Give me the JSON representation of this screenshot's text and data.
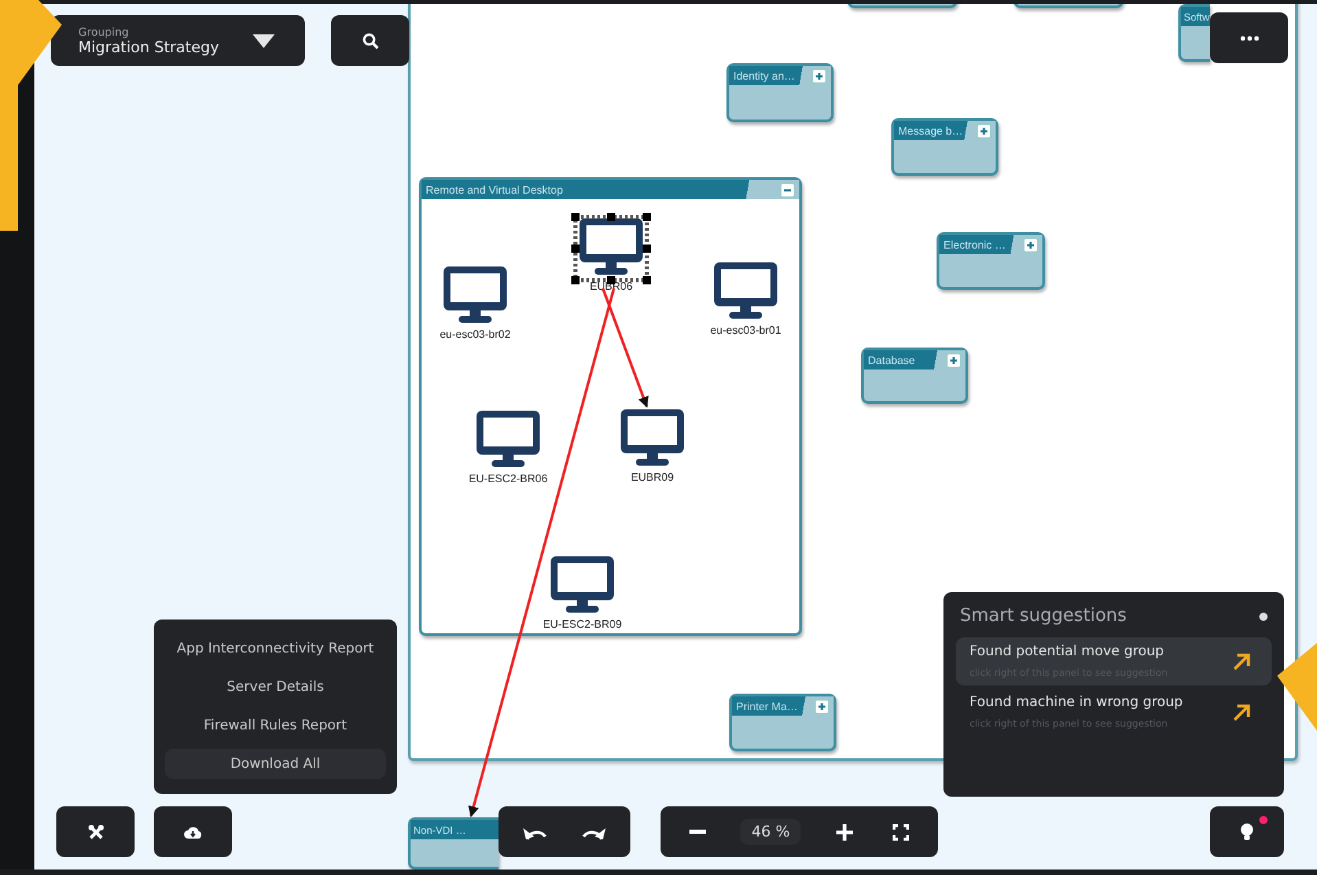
{
  "grouping": {
    "label": "Grouping",
    "value": "Migration Strategy"
  },
  "diagram": {
    "groups": [
      {
        "label": "Remote and Virtual Desktop",
        "expanded": true,
        "nodes": [
          {
            "label": "EUBR06",
            "selected": true
          },
          {
            "label": "eu-esc03-br02",
            "selected": false
          },
          {
            "label": "eu-esc03-br01",
            "selected": false
          },
          {
            "label": "EU-ESC2-BR06",
            "selected": false
          },
          {
            "label": "EUBR09",
            "selected": false
          },
          {
            "label": "EU-ESC2-BR09",
            "selected": false
          }
        ]
      },
      {
        "expanded": false
      },
      {
        "expanded": false
      },
      {
        "label": "Softw",
        "expanded": false
      },
      {
        "label": "Identity an…",
        "expanded": false
      },
      {
        "label": "Message b…",
        "expanded": false
      },
      {
        "label": "Electronic …",
        "expanded": false
      },
      {
        "label": "Database",
        "expanded": false
      },
      {
        "label": "Printer Ma…",
        "expanded": false
      },
      {
        "label": "Non-VDI …",
        "expanded": false
      }
    ],
    "edges": [
      {
        "kind": "arrow"
      },
      {
        "kind": "arrow"
      }
    ]
  },
  "report_menu": {
    "items": [
      {
        "label": "App Interconnectivity Report",
        "selected": false
      },
      {
        "label": "Server Details",
        "selected": false
      },
      {
        "label": "Firewall Rules Report",
        "selected": false
      },
      {
        "label": "Download All",
        "selected": true
      }
    ]
  },
  "zoom": {
    "value": "46 %"
  },
  "suggestions": {
    "title": "Smart suggestions",
    "items": [
      {
        "title": "Found potential move group",
        "hint": "click right of this panel to see suggestion",
        "selected": true
      },
      {
        "title": "Found machine in wrong group",
        "hint": "click right of this panel to see suggestion",
        "selected": false
      }
    ]
  },
  "hints_button": {
    "has_new": true
  }
}
